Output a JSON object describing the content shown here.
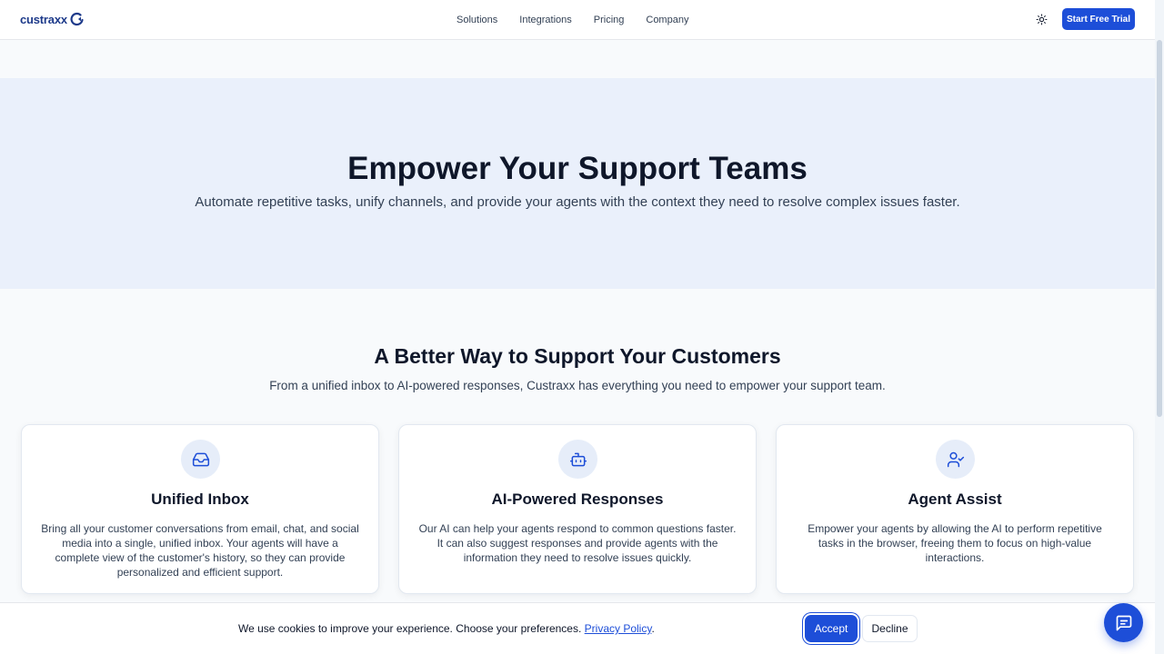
{
  "header": {
    "logo_text": "custraxx",
    "nav": [
      "Solutions",
      "Integrations",
      "Pricing",
      "Company"
    ],
    "theme_toggle_icon": "sun-icon",
    "cta_label": "Start Free Trial"
  },
  "hero": {
    "title": "Empower Your Support Teams",
    "subtitle": "Automate repetitive tasks, unify channels, and provide your agents with the context they need to resolve complex issues faster."
  },
  "features": {
    "title": "A Better Way to Support Your Customers",
    "subtitle": "From a unified inbox to AI-powered responses, Custraxx has everything you need to empower your support team.",
    "cards": [
      {
        "icon": "inbox-icon",
        "title": "Unified Inbox",
        "description": "Bring all your customer conversations from email, chat, and social media into a single, unified inbox. Your agents will have a complete view of the customer's history, so they can provide personalized and efficient support."
      },
      {
        "icon": "bot-icon",
        "title": "AI-Powered Responses",
        "description": "Our AI can help your agents respond to common questions faster. It can also suggest responses and provide agents with the information they need to resolve issues quickly."
      },
      {
        "icon": "user-check-icon",
        "title": "Agent Assist",
        "description": "Empower your agents by allowing the AI to perform repetitive tasks in the browser, freeing them to focus on high-value interactions."
      }
    ]
  },
  "cookie_banner": {
    "text": "We use cookies to improve your experience. Choose your preferences.",
    "link_label": "Privacy Policy",
    "link_suffix": ".",
    "accept_label": "Accept",
    "decline_label": "Decline"
  },
  "chat_widget": {
    "icon": "chat-icon"
  },
  "colors": {
    "brand": "#1d4ed8",
    "hero_bg": "#eaf0fb",
    "icon_bg": "#e6edf9"
  }
}
